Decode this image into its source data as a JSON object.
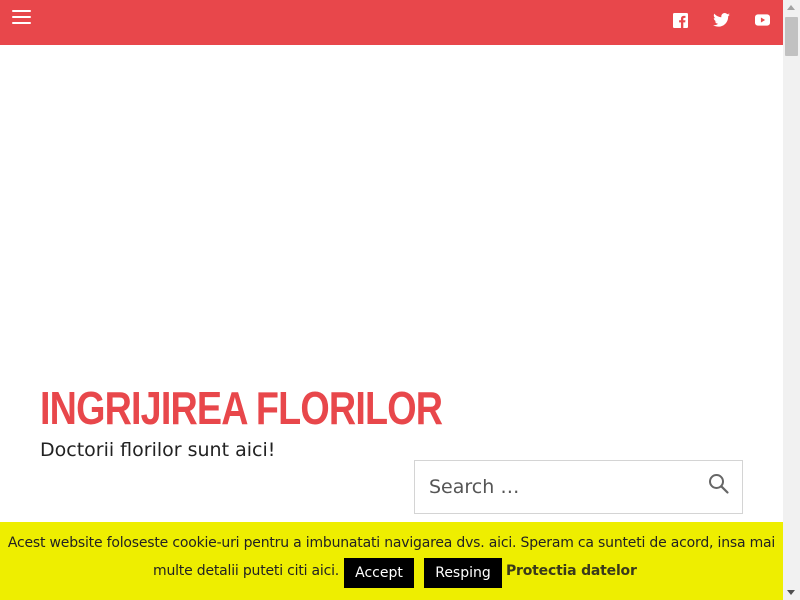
{
  "header": {
    "menu_icon": "hamburger-menu-icon",
    "social": [
      {
        "name": "facebook",
        "icon": "facebook-icon"
      },
      {
        "name": "twitter",
        "icon": "twitter-icon"
      },
      {
        "name": "youtube",
        "icon": "youtube-icon"
      }
    ]
  },
  "site": {
    "title": "INGRIJIREA FLORILOR",
    "tagline": "Doctorii florilor sunt aici!"
  },
  "search": {
    "placeholder": "Search …",
    "icon": "search-icon"
  },
  "cookie": {
    "line1": "Acest website foloseste cookie-uri pentru a imbunatati navigarea dvs. aici. Speram ca sunteti de acord, insa mai",
    "line2": "multe detalii puteti citi aici.",
    "accept_label": "Accept",
    "reject_label": "Resping",
    "privacy_label": "Protectia datelor"
  },
  "colors": {
    "accent": "#e8474b",
    "cookie_bar": "#eeee00",
    "button_bg": "#000000"
  }
}
